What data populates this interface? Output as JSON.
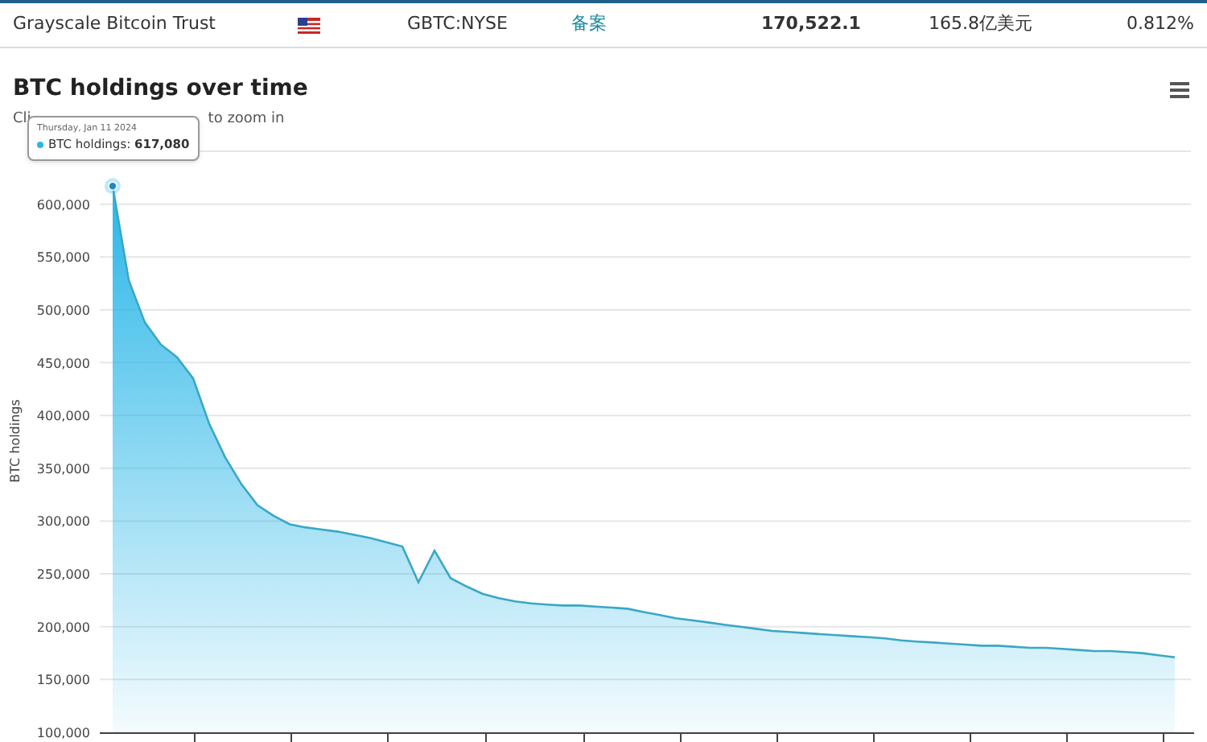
{
  "row": {
    "name": "Grayscale Bitcoin Trust",
    "ticker": "GBTC:NYSE",
    "link": "备案",
    "holdings": "170,522.1",
    "value": "165.8亿美元",
    "share": "0.812%"
  },
  "chart": {
    "title": "BTC holdings over time",
    "subtitle_start": "Cli",
    "subtitle_end": "to zoom in",
    "tooltip": {
      "date": "Thursday, Jan 11 2024",
      "label": "BTC holdings:",
      "value": "617,080"
    },
    "chart_data": {
      "type": "area",
      "ylabel": "BTC holdings",
      "grid": true,
      "ylim": [
        100000,
        650000
      ],
      "yticks": [
        {
          "value": 100000,
          "label": "100,000"
        },
        {
          "value": 150000,
          "label": "150,000"
        },
        {
          "value": 200000,
          "label": "200,000"
        },
        {
          "value": 250000,
          "label": "250,000"
        },
        {
          "value": 300000,
          "label": "300,000"
        },
        {
          "value": 350000,
          "label": "350,000"
        },
        {
          "value": 400000,
          "label": "400,000"
        },
        {
          "value": 450000,
          "label": "450,000"
        },
        {
          "value": 500000,
          "label": "500,000"
        },
        {
          "value": 550000,
          "label": "550,000"
        },
        {
          "value": 600000,
          "label": "600,000"
        }
      ],
      "series": [
        {
          "color": "#29b6e8",
          "values": [
            617080,
            528000,
            488000,
            467000,
            455000,
            435000,
            392000,
            360000,
            335000,
            315000,
            305000,
            297000,
            294000,
            292000,
            290000,
            287000,
            284000,
            280000,
            276000,
            242000,
            272000,
            246000,
            238000,
            231000,
            227000,
            224000,
            222000,
            221000,
            220000,
            220000,
            219000,
            218000,
            217000,
            214000,
            211000,
            208000,
            206000,
            204000,
            202000,
            200000,
            198000,
            196000,
            195000,
            194000,
            193000,
            192000,
            191000,
            190000,
            189000,
            187000,
            186000,
            185000,
            184000,
            183000,
            182000,
            182000,
            181000,
            180000,
            180000,
            179000,
            178000,
            177000,
            177000,
            176000,
            175000,
            173000,
            171000
          ]
        }
      ]
    }
  }
}
